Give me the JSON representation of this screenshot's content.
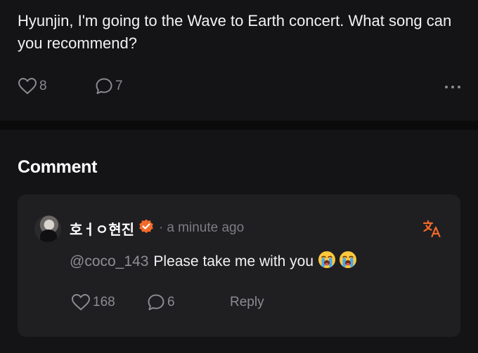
{
  "post": {
    "text": "Hyunjin, I'm going to the Wave to Earth concert. What song can you recommend?",
    "likes": "8",
    "comments": "7",
    "more_icon": "more-horizontal-icon"
  },
  "comments_section": {
    "title": "Comment",
    "items": [
      {
        "author": "호ㅓㅇ현진",
        "verified_icon": "verified-badge-icon",
        "separator": "·",
        "timestamp": "a minute ago",
        "mention": "@coco_143",
        "text": "Please take me with you",
        "emojis": [
          "loudly-crying-face",
          "loudly-crying-face"
        ],
        "likes": "168",
        "replies": "6",
        "reply_label": "Reply",
        "translate_icon": "translate-icon"
      }
    ]
  },
  "colors": {
    "background": "#141416",
    "card": "#1f1f22",
    "divider": "#0b0b0c",
    "muted": "#8b8b90",
    "accent_orange": "#f26a2a"
  }
}
